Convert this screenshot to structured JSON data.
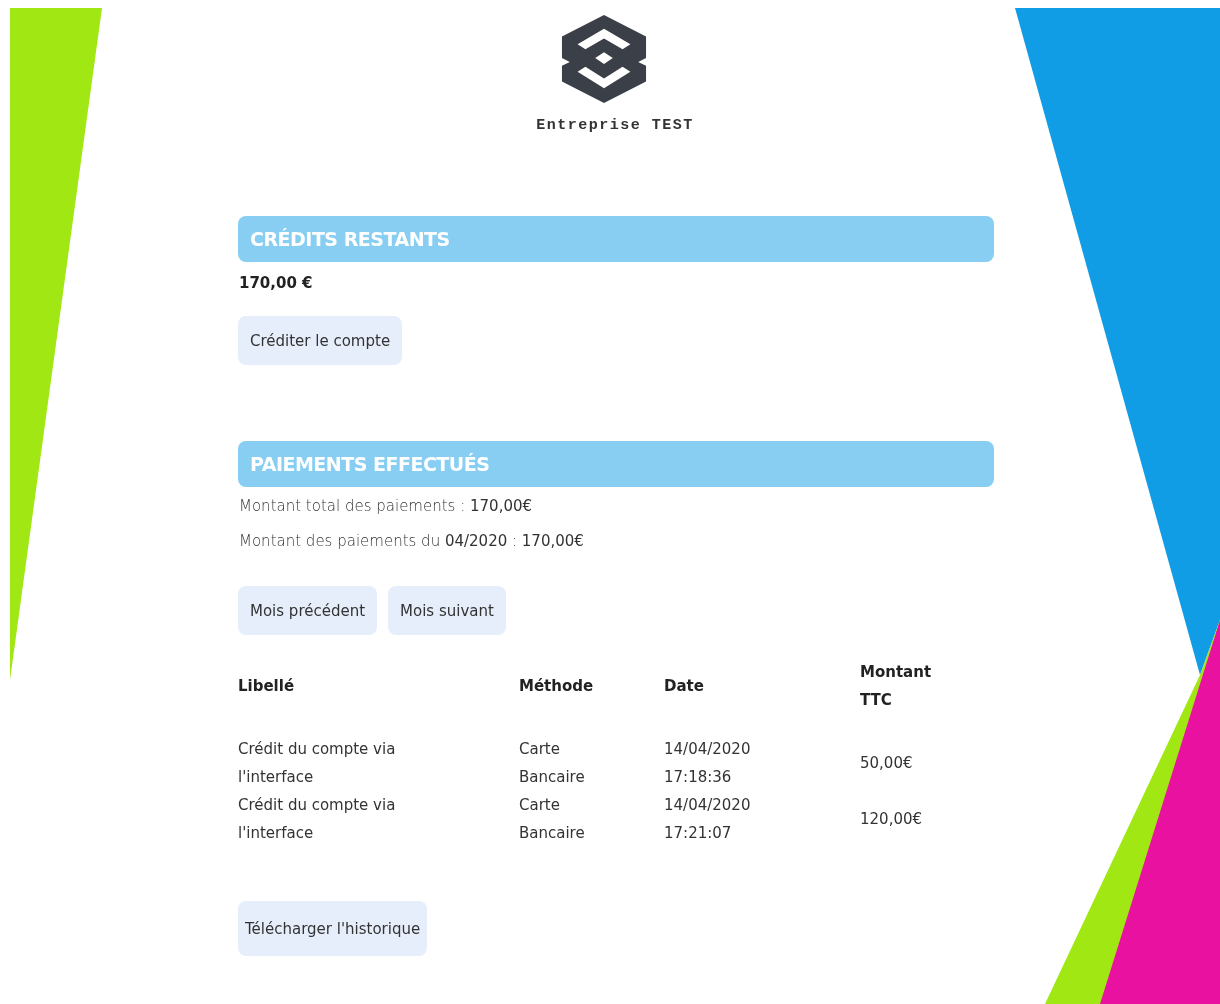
{
  "company": {
    "name": "Entreprise TEST"
  },
  "credits": {
    "title": "CRÉDITS RESTANTS",
    "amount": "170,00 €",
    "button": "Créditer le compte"
  },
  "payments": {
    "title": "PAIEMENTS EFFECTUÉS",
    "summary": [
      "Montant total des paiements : **170,00€**",
      "Montant des paiements du **04/2020** : **170,00€**"
    ],
    "nav_buttons": [
      "Mois précédent",
      "Mois suivant"
    ],
    "table": {
      "columns": [
        "Libellé",
        "Méthode",
        "Date",
        "Montant TTC"
      ],
      "rows": [
        {
          "label": "Crédit du compte via l'interface",
          "method": "Carte Bancaire",
          "date": "14/04/2020 17:18:36",
          "amount": "50,00€"
        },
        {
          "label": "Crédit du compte via l'interface",
          "method": "Carte Bancaire",
          "date": "14/04/2020 17:21:07",
          "amount": "120,00€"
        }
      ]
    },
    "download_button": "Télécharger l'historique"
  }
}
